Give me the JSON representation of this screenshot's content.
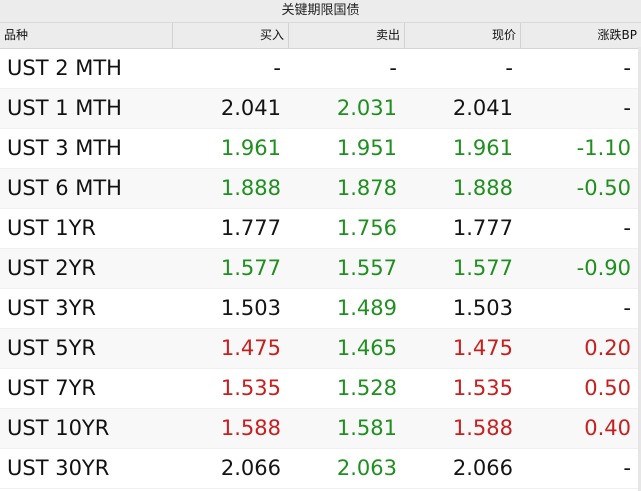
{
  "title": "关键期限国债",
  "columns": {
    "name": "品种",
    "bid": "买入",
    "ask": "卖出",
    "last": "现价",
    "change": "涨跌BP"
  },
  "colors": {
    "up": "#c81e1e",
    "down": "#1f8f1f",
    "neutral": "#141414"
  },
  "rows": [
    {
      "name": "UST 2 MTH",
      "bid": "-",
      "ask": "-",
      "last": "-",
      "change": "-",
      "bid_color": "black",
      "ask_color": "black",
      "last_color": "black",
      "change_color": "black"
    },
    {
      "name": "UST 1 MTH",
      "bid": "2.041",
      "ask": "2.031",
      "last": "2.041",
      "change": "-",
      "bid_color": "black",
      "ask_color": "green",
      "last_color": "black",
      "change_color": "black"
    },
    {
      "name": "UST 3 MTH",
      "bid": "1.961",
      "ask": "1.951",
      "last": "1.961",
      "change": "-1.10",
      "bid_color": "green",
      "ask_color": "green",
      "last_color": "green",
      "change_color": "green"
    },
    {
      "name": "UST 6 MTH",
      "bid": "1.888",
      "ask": "1.878",
      "last": "1.888",
      "change": "-0.50",
      "bid_color": "green",
      "ask_color": "green",
      "last_color": "green",
      "change_color": "green"
    },
    {
      "name": "UST 1YR",
      "bid": "1.777",
      "ask": "1.756",
      "last": "1.777",
      "change": "-",
      "bid_color": "black",
      "ask_color": "green",
      "last_color": "black",
      "change_color": "black"
    },
    {
      "name": "UST 2YR",
      "bid": "1.577",
      "ask": "1.557",
      "last": "1.577",
      "change": "-0.90",
      "bid_color": "green",
      "ask_color": "green",
      "last_color": "green",
      "change_color": "green"
    },
    {
      "name": "UST 3YR",
      "bid": "1.503",
      "ask": "1.489",
      "last": "1.503",
      "change": "-",
      "bid_color": "black",
      "ask_color": "green",
      "last_color": "black",
      "change_color": "black"
    },
    {
      "name": "UST 5YR",
      "bid": "1.475",
      "ask": "1.465",
      "last": "1.475",
      "change": "0.20",
      "bid_color": "red",
      "ask_color": "green",
      "last_color": "red",
      "change_color": "red"
    },
    {
      "name": "UST 7YR",
      "bid": "1.535",
      "ask": "1.528",
      "last": "1.535",
      "change": "0.50",
      "bid_color": "red",
      "ask_color": "green",
      "last_color": "red",
      "change_color": "red"
    },
    {
      "name": "UST 10YR",
      "bid": "1.588",
      "ask": "1.581",
      "last": "1.588",
      "change": "0.40",
      "bid_color": "red",
      "ask_color": "green",
      "last_color": "red",
      "change_color": "red"
    },
    {
      "name": "UST 30YR",
      "bid": "2.066",
      "ask": "2.063",
      "last": "2.066",
      "change": "-",
      "bid_color": "black",
      "ask_color": "green",
      "last_color": "black",
      "change_color": "black"
    }
  ]
}
